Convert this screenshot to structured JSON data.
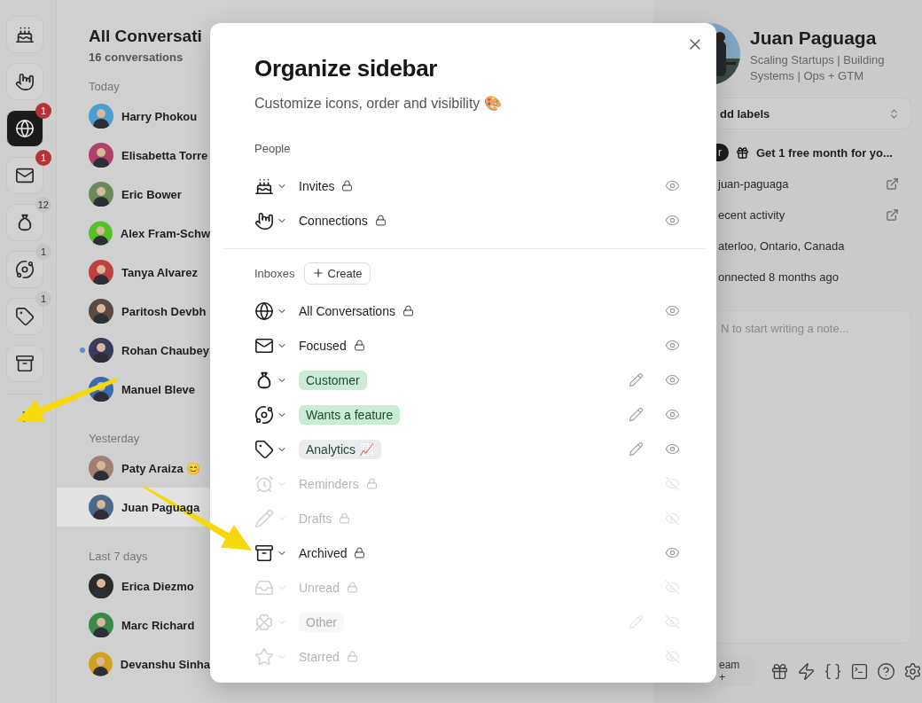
{
  "rail": {
    "items": [
      {
        "selected": false
      },
      {
        "selected": false
      },
      {
        "selected": true,
        "badge": "1",
        "alert": true
      },
      {
        "selected": false,
        "badge": "1",
        "alert": true
      },
      {
        "selected": false,
        "badge": "12",
        "alert": false
      },
      {
        "selected": false,
        "badge": "1",
        "alert": false
      },
      {
        "selected": false,
        "badge": "1",
        "alert": false
      },
      {
        "selected": false
      }
    ]
  },
  "conversations": {
    "title": "All Conversati",
    "count": "16 conversations",
    "groups": [
      {
        "label": "Today",
        "rows": [
          {
            "name": "Harry Phokou",
            "unread": false,
            "selected": false
          },
          {
            "name": "Elisabetta Torre",
            "unread": false,
            "selected": false
          },
          {
            "name": "Eric Bower",
            "unread": false,
            "selected": false
          },
          {
            "name": "Alex Fram-Schw",
            "unread": false,
            "selected": false
          },
          {
            "name": "Tanya Alvarez",
            "unread": false,
            "selected": false
          },
          {
            "name": "Paritosh Devbh",
            "unread": false,
            "selected": false
          },
          {
            "name": "Rohan Chaubey",
            "unread": true,
            "selected": false
          },
          {
            "name": "Manuel Bleve",
            "unread": false,
            "selected": false
          }
        ]
      },
      {
        "label": "Yesterday",
        "rows": [
          {
            "name": "Paty Araiza 😊",
            "unread": false,
            "selected": false
          },
          {
            "name": "Juan Paguaga",
            "unread": false,
            "selected": true
          }
        ]
      },
      {
        "label": "Last 7 days",
        "rows": [
          {
            "name": "Erica Diezmo",
            "unread": false,
            "selected": false
          },
          {
            "name": "Marc Richard",
            "unread": false,
            "selected": false
          },
          {
            "name": "Devanshu Sinha",
            "unread": false,
            "selected": false
          }
        ]
      }
    ]
  },
  "profile": {
    "name": "Juan Paguaga",
    "bio": "Scaling Startups | Building Systems | Ops + GTM",
    "labels_select": "dd labels",
    "badge": "r",
    "promo": "Get 1 free month for yo...",
    "links": [
      {
        "text": "juan-paguaga",
        "external": true
      },
      {
        "text": "ecent activity",
        "external": true
      },
      {
        "text": "aterloo, Ontario, Canada",
        "external": false
      },
      {
        "text": "onnected 8 months ago",
        "external": false
      }
    ],
    "note_placeholder": "N to start writing a note...",
    "invite": "eam +"
  },
  "dialog": {
    "title": "Organize sidebar",
    "subtitle": "Customize icons, order and visibility 🎨",
    "sections": [
      {
        "label": "People",
        "items": [
          {
            "label": "Invites",
            "kind": "fixed",
            "visible": true
          },
          {
            "label": "Connections",
            "kind": "fixed",
            "visible": true
          }
        ]
      },
      {
        "label": "Inboxes",
        "action": "Create",
        "items": [
          {
            "label": "All Conversations",
            "kind": "fixed",
            "visible": true
          },
          {
            "label": "Focused",
            "kind": "fixed",
            "visible": true
          },
          {
            "label": "Customer",
            "kind": "label",
            "color": "#c8ecd6",
            "visible": true
          },
          {
            "label": "Wants a feature",
            "kind": "label",
            "color": "#c8ecd6",
            "visible": true
          },
          {
            "label": "Analytics 📈",
            "kind": "label",
            "color": "#ececef",
            "visible": true
          },
          {
            "label": "Reminders",
            "kind": "fixed",
            "visible": false
          },
          {
            "label": "Drafts",
            "kind": "fixed",
            "visible": false
          },
          {
            "label": "Archived",
            "kind": "fixed",
            "visible": true
          },
          {
            "label": "Unread",
            "kind": "fixed",
            "visible": false
          },
          {
            "label": "Other",
            "kind": "label",
            "color": "#f7f7f7",
            "visible": false
          },
          {
            "label": "Starred",
            "kind": "fixed",
            "visible": false
          }
        ]
      }
    ]
  }
}
